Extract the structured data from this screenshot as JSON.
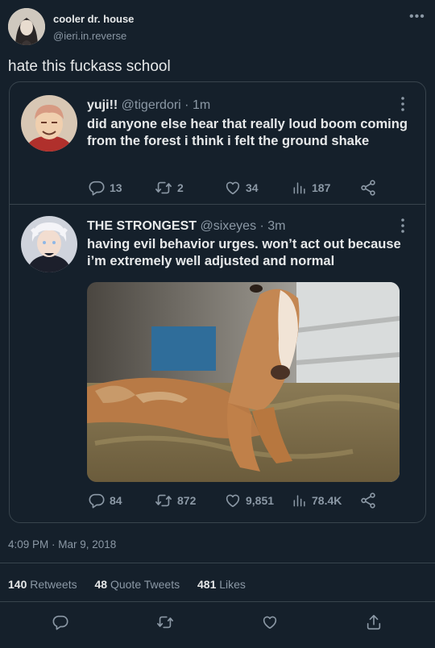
{
  "tweet": {
    "author_name": "cooler dr. house",
    "author_handle": "@ieri.in.reverse",
    "more": "•••",
    "text": "hate this fuckass school",
    "timestamp": "4:09 PM · Mar 9, 2018",
    "stats": {
      "retweets_count": "140",
      "retweets_label": "Retweets",
      "quotes_count": "48",
      "quotes_label": "Quote Tweets",
      "likes_count": "481",
      "likes_label": "Likes"
    }
  },
  "quoted": [
    {
      "name": "yuji!!",
      "handle_time": "@tigerdori · 1m",
      "text": "did anyone else hear that really loud boom coming from the forest i think i felt the ground shake",
      "replies": "13",
      "retweets": "2",
      "likes": "34",
      "views": "187"
    },
    {
      "name": "THE STRONGEST",
      "handle_time": "@sixeyes · 3m",
      "text": "having evil behavior urges. won’t act out because i’m extremely well adjusted and normal",
      "replies": "84",
      "retweets": "872",
      "likes": "9,851",
      "views": "78.4K"
    }
  ],
  "colors": {
    "background": "#15202b",
    "border": "#38444d",
    "muted": "#8b98a5",
    "text": "#e7e9ea"
  },
  "icons": [
    "reply-icon",
    "retweet-icon",
    "like-icon",
    "views-icon",
    "share-icon",
    "more-icon"
  ]
}
